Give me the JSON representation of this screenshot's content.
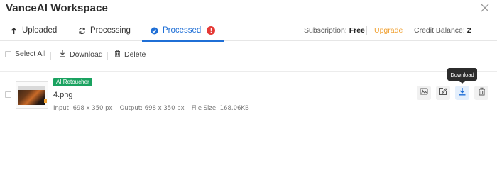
{
  "app": {
    "title": "VanceAI Workspace"
  },
  "tabs": [
    {
      "label": "Uploaded",
      "icon": "upload-arrow-icon",
      "active": false
    },
    {
      "label": "Processing",
      "icon": "refresh-icon",
      "active": false
    },
    {
      "label": "Processed",
      "icon": "check-circle-icon",
      "active": true,
      "alert": "!"
    }
  ],
  "subscription": {
    "label": "Subscription:",
    "value": "Free",
    "upgrade": "Upgrade"
  },
  "credit": {
    "label": "Credit Balance:",
    "value": "2"
  },
  "toolbar": {
    "select_all": "Select All",
    "download": "Download",
    "delete": "Delete"
  },
  "files": [
    {
      "badge": "AI Retoucher",
      "name": "4.png",
      "input": "Input: 698 x 350 px",
      "output": "Output: 698 x 350 px",
      "size": "File Size: 168.06KB"
    }
  ],
  "tooltip": "Download",
  "colors": {
    "accent": "#1f6fd6",
    "upgrade": "#f0a030",
    "badge": "#1aa260",
    "alert": "#e53935"
  }
}
